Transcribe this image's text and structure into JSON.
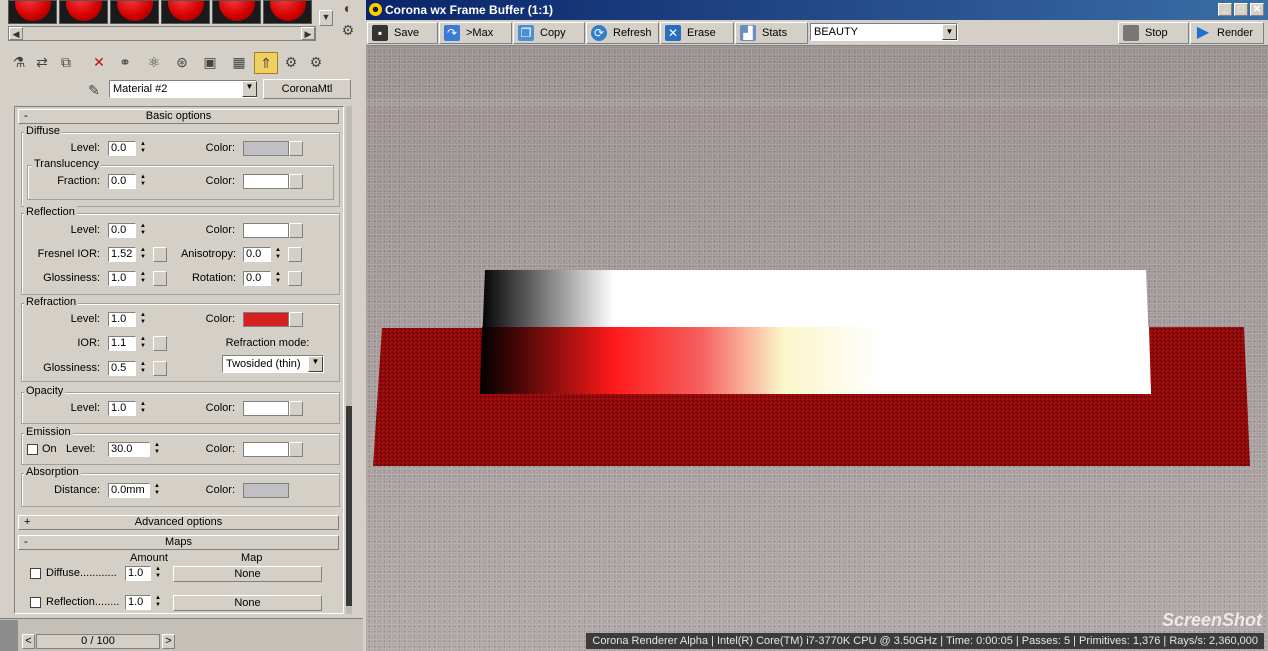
{
  "material_editor": {
    "material_name": "Material #2",
    "material_type": "CoronaMtl",
    "rollout_basic": "Basic options",
    "rollout_advanced": "Advanced options",
    "rollout_maps": "Maps",
    "collapse_sign": "-",
    "expand_sign": "+",
    "diffuse": {
      "group": "Diffuse",
      "level_label": "Level:",
      "level": "0.0",
      "color_label": "Color:",
      "color": "#c0c0c4"
    },
    "translucency": {
      "group": "Translucency",
      "fraction_label": "Fraction:",
      "fraction": "0.0",
      "color_label": "Color:",
      "color": "#ffffff"
    },
    "reflection": {
      "group": "Reflection",
      "level_label": "Level:",
      "level": "0.0",
      "color_label": "Color:",
      "color": "#ffffff",
      "fresnel_label": "Fresnel IOR:",
      "fresnel": "1.52",
      "aniso_label": "Anisotropy:",
      "aniso": "0.0",
      "gloss_label": "Glossiness:",
      "gloss": "1.0",
      "rotation_label": "Rotation:",
      "rotation": "0.0"
    },
    "refraction": {
      "group": "Refraction",
      "level_label": "Level:",
      "level": "1.0",
      "color_label": "Color:",
      "color": "#d42020",
      "ior_label": "IOR:",
      "ior": "1.1",
      "mode_label": "Refraction mode:",
      "mode": "Twosided (thin)",
      "gloss_label": "Glossiness:",
      "gloss": "0.5"
    },
    "opacity": {
      "group": "Opacity",
      "level_label": "Level:",
      "level": "1.0",
      "color_label": "Color:",
      "color": "#ffffff"
    },
    "emission": {
      "group": "Emission",
      "on_label": "On",
      "level_label": "Level:",
      "level": "30.0",
      "color_label": "Color:",
      "color": "#ffffff"
    },
    "absorption": {
      "group": "Absorption",
      "distance_label": "Distance:",
      "distance": "0.0mm",
      "color_label": "Color:",
      "color": "#c0c0c4"
    },
    "maps": {
      "amount_header": "Amount",
      "map_header": "Map",
      "rows": [
        {
          "label": "Diffuse............",
          "amount": "1.0",
          "map": "None"
        },
        {
          "label": "Reflection........",
          "amount": "1.0",
          "map": "None"
        }
      ]
    },
    "timeline": {
      "frame": "0 / 100",
      "prev": "<",
      "next": ">"
    }
  },
  "frame_buffer": {
    "title": "Corona wx Frame Buffer (1:1)",
    "toolbar": {
      "save": "Save",
      "max": ">Max",
      "copy": "Copy",
      "refresh": "Refresh",
      "erase": "Erase",
      "stats": "Stats",
      "channel": "BEAUTY",
      "stop": "Stop",
      "render": "Render"
    },
    "status": "Corona Renderer Alpha | Intel(R) Core(TM) i7-3770K CPU @ 3.50GHz | Time: 0:00:05 | Passes: 5 | Primitives: 1,376 | Rays/s: 2,360,000",
    "watermark": "ScreenShot"
  }
}
